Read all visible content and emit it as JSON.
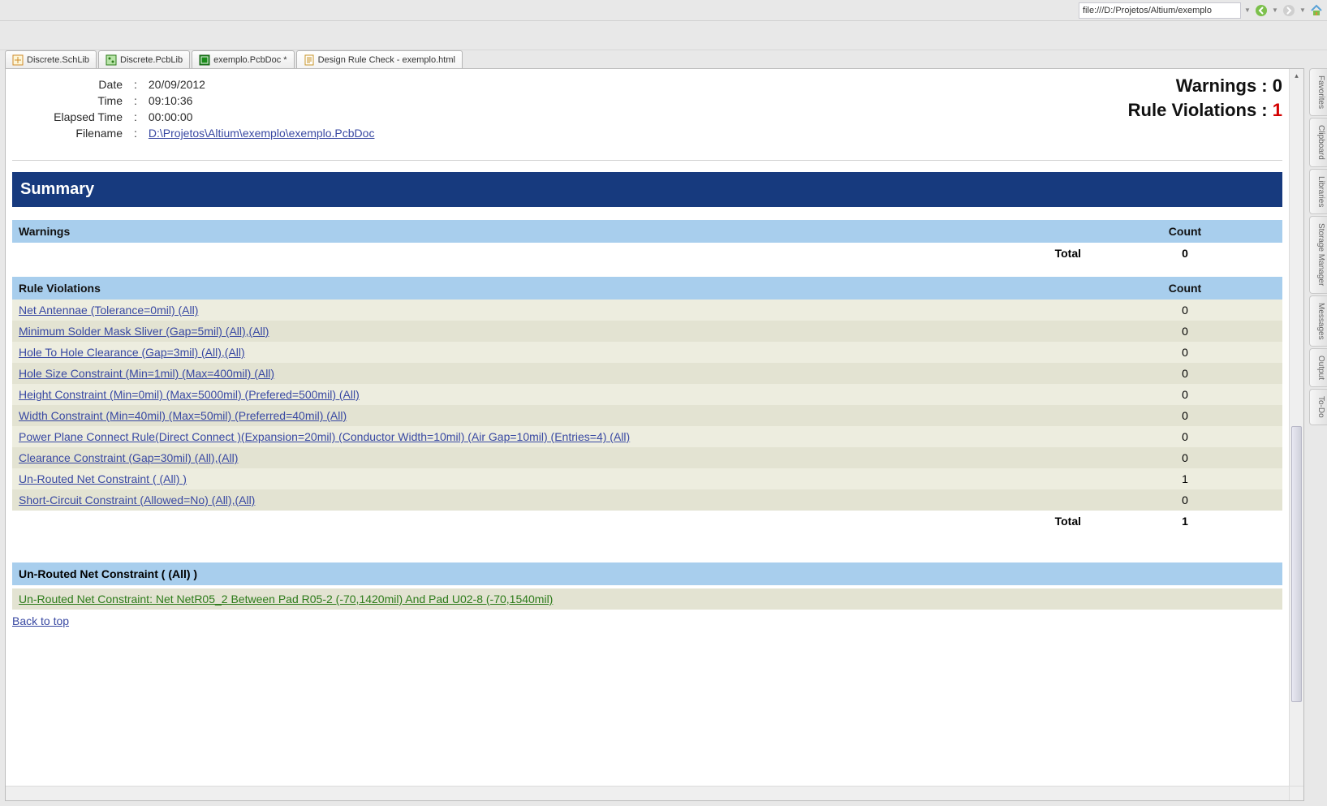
{
  "addressbar": {
    "url": "file:///D:/Projetos/Altium/exemplo"
  },
  "tabs": [
    {
      "label": "Discrete.SchLib",
      "type": "sch"
    },
    {
      "label": "Discrete.PcbLib",
      "type": "pcblib"
    },
    {
      "label": "exemplo.PcbDoc *",
      "type": "pcb"
    },
    {
      "label": "Design Rule Check - exemplo.html",
      "type": "html",
      "active": true
    }
  ],
  "side_tabs": [
    "Favorites",
    "Clipboard",
    "Libraries",
    "Storage Manager",
    "Messages",
    "Output",
    "To-Do"
  ],
  "meta": {
    "date_label": "Date",
    "date_value": "20/09/2012",
    "time_label": "Time",
    "time_value": "09:10:36",
    "elapsed_label": "Elapsed Time",
    "elapsed_value": "00:00:00",
    "filename_label": "Filename",
    "filename_value": "D:\\Projetos\\Altium\\exemplo\\exemplo.PcbDoc"
  },
  "stats": {
    "warnings_label": "Warnings :",
    "warnings_value": "0",
    "rv_label": "Rule Violations :",
    "rv_value": "1"
  },
  "summary": {
    "label": "Summary"
  },
  "warnings_section": {
    "heading": "Warnings",
    "count_heading": "Count",
    "total_label": "Total",
    "total_value": "0"
  },
  "rules_section": {
    "heading": "Rule Violations",
    "count_heading": "Count",
    "rows": [
      {
        "text": "Net Antennae (Tolerance=0mil) (All)",
        "count": "0"
      },
      {
        "text": "Minimum Solder Mask Sliver (Gap=5mil) (All),(All)",
        "count": "0"
      },
      {
        "text": "Hole To Hole Clearance (Gap=3mil) (All),(All)",
        "count": "0"
      },
      {
        "text": "Hole Size Constraint (Min=1mil) (Max=400mil) (All)",
        "count": "0"
      },
      {
        "text": "Height Constraint (Min=0mil) (Max=5000mil) (Prefered=500mil) (All)",
        "count": "0"
      },
      {
        "text": "Width Constraint (Min=40mil) (Max=50mil) (Preferred=40mil) (All)",
        "count": "0"
      },
      {
        "text": "Power Plane Connect Rule(Direct Connect )(Expansion=20mil) (Conductor Width=10mil) (Air Gap=10mil) (Entries=4) (All)",
        "count": "0"
      },
      {
        "text": "Clearance Constraint (Gap=30mil) (All),(All)",
        "count": "0"
      },
      {
        "text": "Un-Routed Net Constraint ( (All) )",
        "count": "1"
      },
      {
        "text": "Short-Circuit Constraint (Allowed=No) (All),(All)",
        "count": "0"
      }
    ],
    "total_label": "Total",
    "total_value": "1"
  },
  "violation_detail": {
    "heading": "Un-Routed Net Constraint ( (All) )",
    "item": "Un-Routed Net Constraint: Net NetR05_2 Between Pad R05-2 (-70,1420mil) And Pad U02-8 (-70,1540mil)",
    "back": "Back to top"
  }
}
